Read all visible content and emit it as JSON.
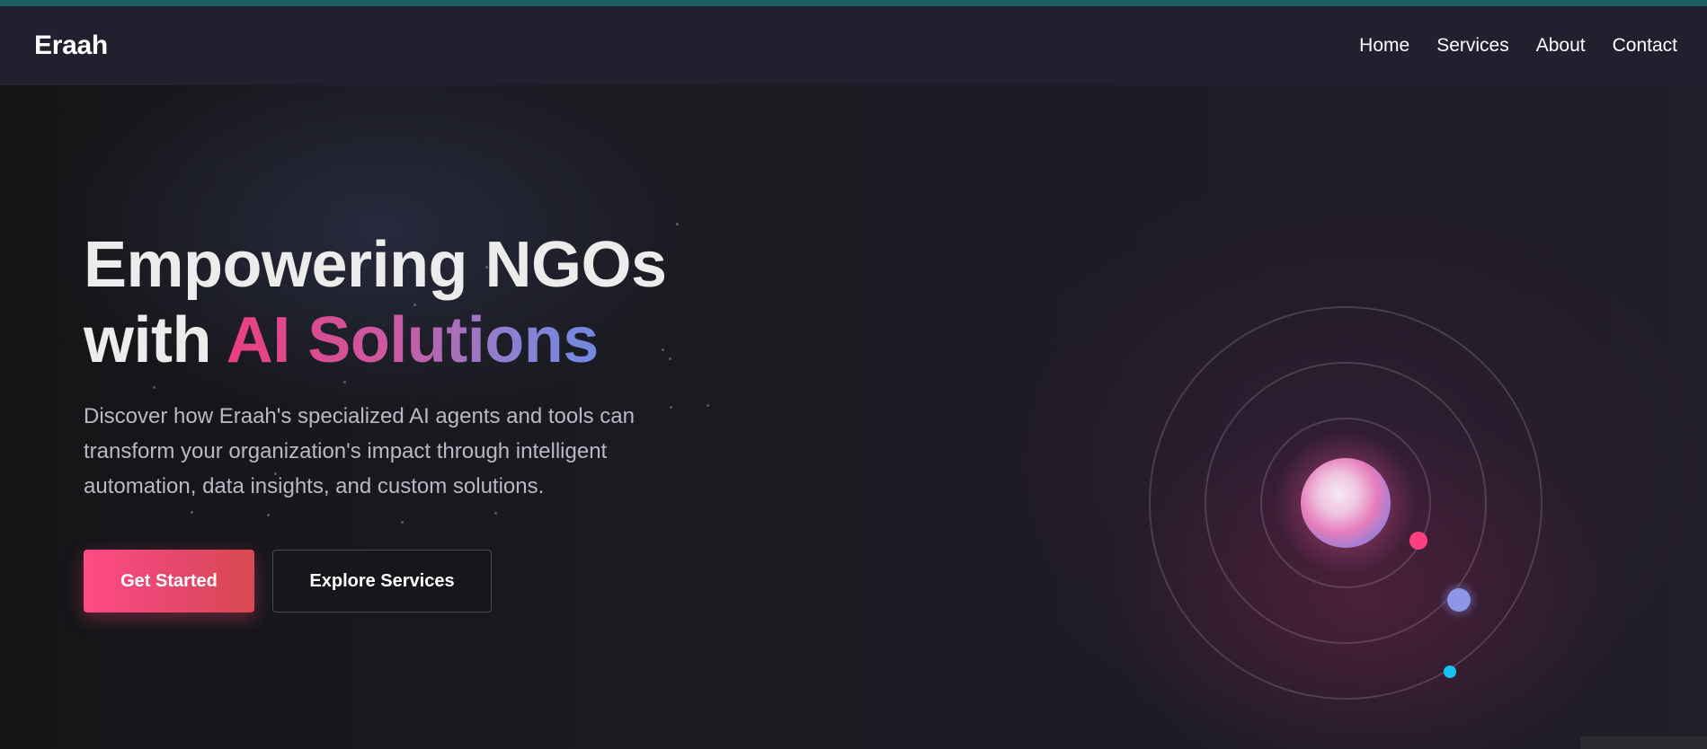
{
  "brand": {
    "name": "Eraah"
  },
  "nav": {
    "items": [
      {
        "label": "Home"
      },
      {
        "label": "Services"
      },
      {
        "label": "About"
      },
      {
        "label": "Contact"
      }
    ]
  },
  "hero": {
    "headline_line1": "Empowering NGOs",
    "headline_line2_prefix": "with ",
    "headline_line2_highlight": "AI Solutions",
    "description": "Discover how Eraah's specialized AI agents and tools can transform your organization's impact through intelligent automation, data insights, and custom solutions.",
    "primary_cta": "Get Started",
    "secondary_cta": "Explore Services"
  },
  "colors": {
    "accent_pink": "#ff4b86",
    "accent_purple": "#8f7fd0",
    "accent_cyan": "#17c3f0",
    "nav_bg": "#20202f",
    "top_strip": "#1d5f63"
  }
}
